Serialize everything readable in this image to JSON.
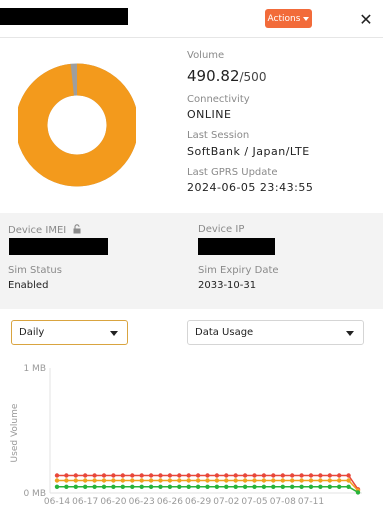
{
  "header": {
    "actions_label": "Actions",
    "close_glyph": "✕"
  },
  "colors": {
    "accent": "#f26b3a",
    "usage": "#f39a1c",
    "remaining": "#9e9e9e"
  },
  "summary": {
    "volume_label": "Volume",
    "volume_used": "490.82",
    "volume_max": "/500",
    "connectivity_label": "Connectivity",
    "connectivity_value": "ONLINE",
    "last_session_label": "Last Session",
    "last_session_value": "SoftBank / Japan/LTE",
    "last_gprs_label": "Last GPRS Update",
    "last_gprs_value": "2024-06-05 23:43:55",
    "usage_fraction": 0.98164
  },
  "device": {
    "imei_label": "Device IMEI",
    "ip_label": "Device IP",
    "sim_status_label": "Sim Status",
    "sim_status_value": "Enabled",
    "sim_expiry_label": "Sim Expiry Date",
    "sim_expiry_value": "2033-10-31"
  },
  "filters": {
    "period": "Daily",
    "metric": "Data Usage"
  },
  "chart_data": {
    "type": "line",
    "ylabel": "Used Volume",
    "y_ticks": [
      "1 MB",
      "0 MB"
    ],
    "ylim": [
      0,
      1
    ],
    "grid": false,
    "x_tick_labels": [
      "06-14",
      "06-17",
      "06-20",
      "06-23",
      "06-26",
      "06-29",
      "07-02",
      "07-05",
      "07-08",
      "07-11"
    ],
    "series": [
      {
        "color": "#e8473a",
        "values": [
          0.14,
          0.14,
          0.14,
          0.14,
          0.14,
          0.14,
          0.14,
          0.14,
          0.14,
          0.14,
          0.14,
          0.14,
          0.14,
          0.14,
          0.14,
          0.14,
          0.14,
          0.14,
          0.14,
          0.14,
          0.14,
          0.14,
          0.14,
          0.14,
          0.14,
          0.14,
          0.14,
          0.14,
          0.14,
          0.14,
          0.14,
          0.14,
          0.03
        ]
      },
      {
        "color": "#f0a020",
        "values": [
          0.1,
          0.1,
          0.1,
          0.1,
          0.1,
          0.1,
          0.1,
          0.1,
          0.1,
          0.1,
          0.1,
          0.1,
          0.1,
          0.1,
          0.1,
          0.1,
          0.1,
          0.1,
          0.1,
          0.1,
          0.1,
          0.1,
          0.1,
          0.1,
          0.1,
          0.1,
          0.1,
          0.1,
          0.1,
          0.1,
          0.1,
          0.1,
          0.02
        ]
      },
      {
        "color": "#27b33a",
        "values": [
          0.05,
          0.05,
          0.05,
          0.05,
          0.05,
          0.05,
          0.05,
          0.05,
          0.05,
          0.05,
          0.05,
          0.05,
          0.05,
          0.05,
          0.05,
          0.05,
          0.05,
          0.05,
          0.05,
          0.05,
          0.05,
          0.05,
          0.05,
          0.05,
          0.05,
          0.05,
          0.05,
          0.05,
          0.05,
          0.05,
          0.05,
          0.05,
          0.005
        ]
      }
    ]
  }
}
